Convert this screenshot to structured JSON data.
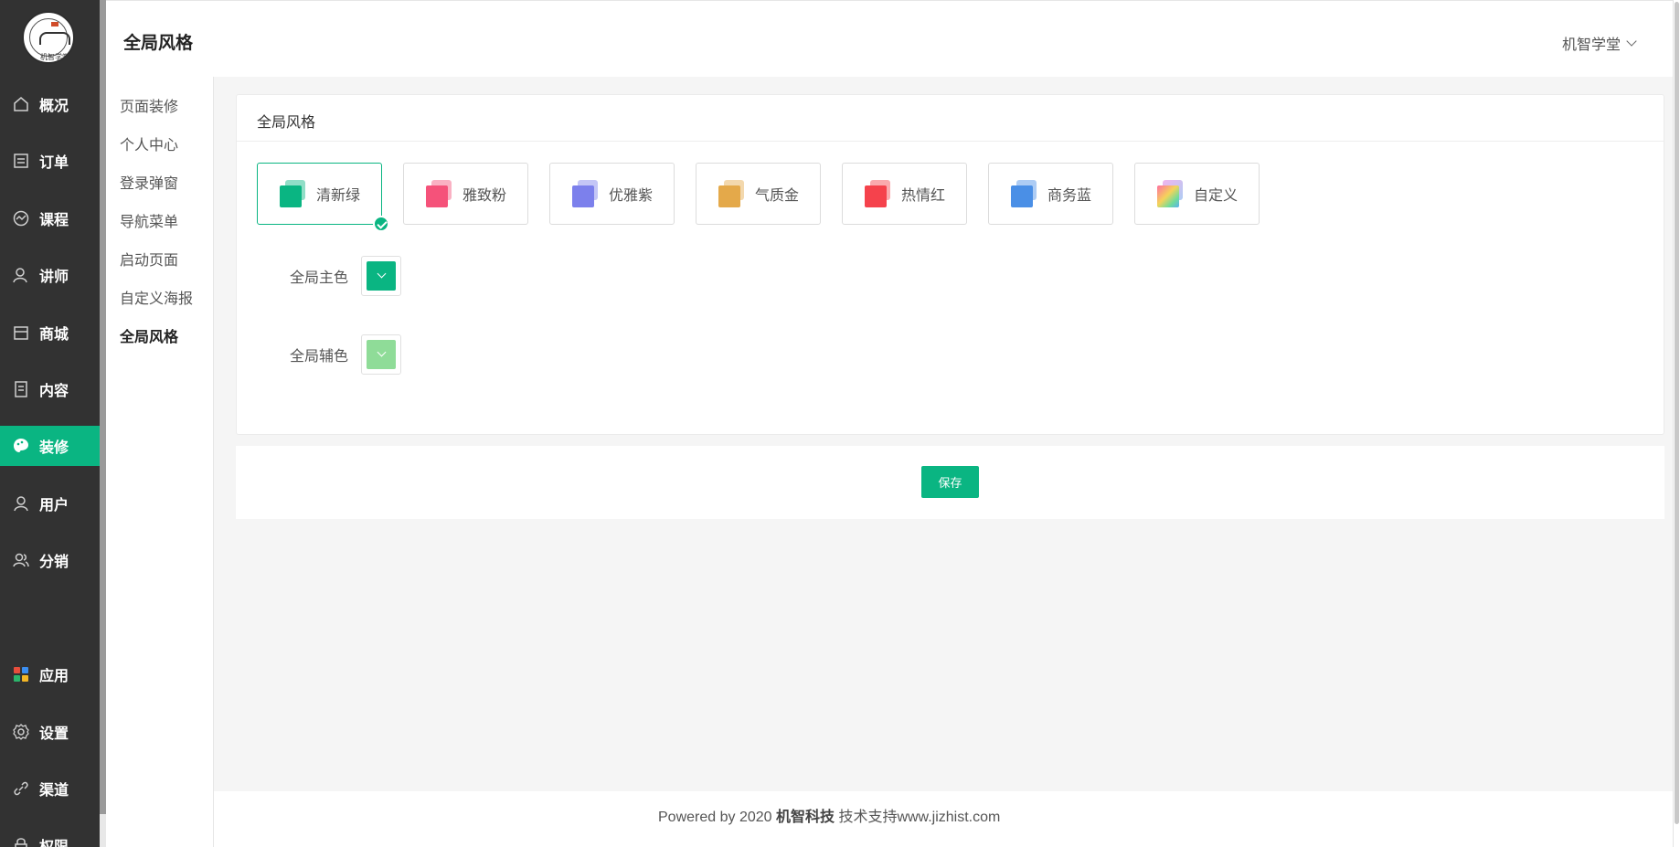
{
  "logo": {
    "text": "机智学堂"
  },
  "nav": {
    "items": [
      {
        "label": "概况",
        "icon": "home-icon"
      },
      {
        "label": "订单",
        "icon": "order-icon"
      },
      {
        "label": "课程",
        "icon": "course-icon"
      },
      {
        "label": "讲师",
        "icon": "teacher-icon"
      },
      {
        "label": "商城",
        "icon": "shop-icon"
      },
      {
        "label": "内容",
        "icon": "content-icon"
      },
      {
        "label": "装修",
        "icon": "decorate-icon"
      },
      {
        "label": "用户",
        "icon": "user-icon"
      },
      {
        "label": "分销",
        "icon": "distribution-icon"
      },
      {
        "label": "应用",
        "icon": "apps-icon"
      },
      {
        "label": "设置",
        "icon": "settings-icon"
      },
      {
        "label": "渠道",
        "icon": "channel-icon"
      },
      {
        "label": "权限",
        "icon": "permission-icon"
      }
    ],
    "active": "装修"
  },
  "header": {
    "title": "全局风格",
    "user_name": "机智学堂"
  },
  "subnav": {
    "items": [
      "页面装修",
      "个人中心",
      "登录弹窗",
      "导航菜单",
      "启动页面",
      "自定义海报",
      "全局风格"
    ],
    "active": "全局风格"
  },
  "card": {
    "title": "全局风格"
  },
  "themes": [
    {
      "label": "清新绿",
      "color": "#0ab582",
      "selected": true
    },
    {
      "label": "雅致粉",
      "color": "#f5527a",
      "selected": false
    },
    {
      "label": "优雅紫",
      "color": "#7c80ec",
      "selected": false
    },
    {
      "label": "气质金",
      "color": "#e4a94a",
      "selected": false
    },
    {
      "label": "热情红",
      "color": "#f5424c",
      "selected": false
    },
    {
      "label": "商务蓝",
      "color": "#4a8fe6",
      "selected": false
    },
    {
      "label": "自定义",
      "color": "gradient",
      "selected": false
    }
  ],
  "colors": {
    "primary_label": "全局主色",
    "primary_value": "#0ab582",
    "secondary_label": "全局辅色",
    "secondary_value": "#8fdc98"
  },
  "save": {
    "label": "保存"
  },
  "footer": {
    "prefix": "Powered by 2020 ",
    "company": "机智科技",
    "suffix": " 技术支持www.jizhist.com"
  }
}
